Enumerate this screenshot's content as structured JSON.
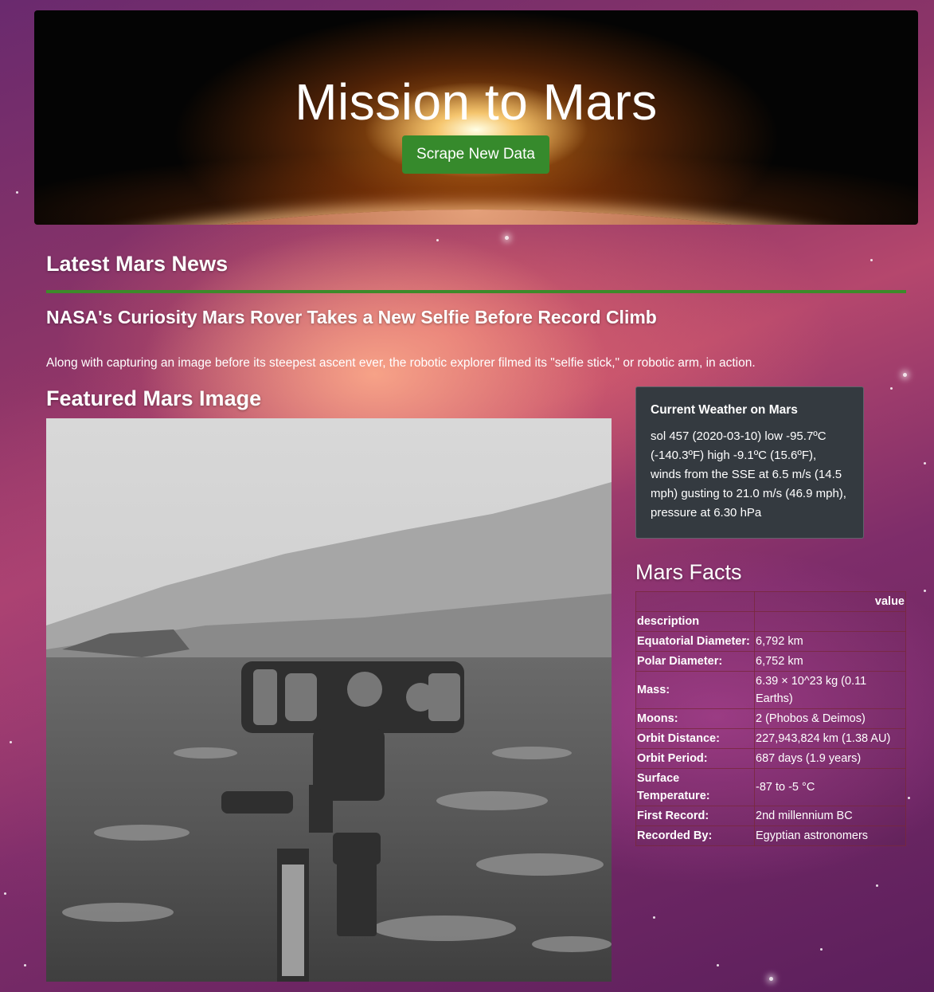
{
  "header": {
    "title": "Mission to Mars",
    "scrape_button_label": "Scrape New Data"
  },
  "news": {
    "section_title": "Latest Mars News",
    "headline": "NASA's Curiosity Mars Rover Takes a New Selfie Before Record Climb",
    "teaser": "Along with capturing an image before its steepest ascent ever, the robotic explorer filmed its \"selfie stick,\" or robotic arm, in action."
  },
  "featured": {
    "section_title": "Featured Mars Image"
  },
  "weather": {
    "card_title": "Current Weather on Mars",
    "text": "sol 457 (2020-03-10) low -95.7ºC (-140.3ºF) high -9.1ºC (15.6ºF), winds from the SSE at 6.5 m/s (14.5 mph) gusting to 21.0 m/s (46.9 mph), pressure at 6.30 hPa"
  },
  "facts": {
    "section_title": "Mars Facts",
    "value_header": "value",
    "index_header": "description",
    "rows": [
      {
        "label": "Equatorial Diameter:",
        "value": "6,792 km"
      },
      {
        "label": "Polar Diameter:",
        "value": "6,752 km"
      },
      {
        "label": "Mass:",
        "value": "6.39 × 10^23 kg (0.11 Earths)"
      },
      {
        "label": "Moons:",
        "value": "2 (Phobos & Deimos)"
      },
      {
        "label": "Orbit Distance:",
        "value": "227,943,824 km (1.38 AU)"
      },
      {
        "label": "Orbit Period:",
        "value": "687 days (1.9 years)"
      },
      {
        "label": "Surface Temperature:",
        "value": "-87 to -5 °C"
      },
      {
        "label": "First Record:",
        "value": "2nd millennium BC"
      },
      {
        "label": "Recorded By:",
        "value": "Egyptian astronomers"
      }
    ]
  },
  "colors": {
    "scrape_button": "#368a2c",
    "news_rule": "#3d8a2a",
    "weather_card": "#343a40"
  }
}
